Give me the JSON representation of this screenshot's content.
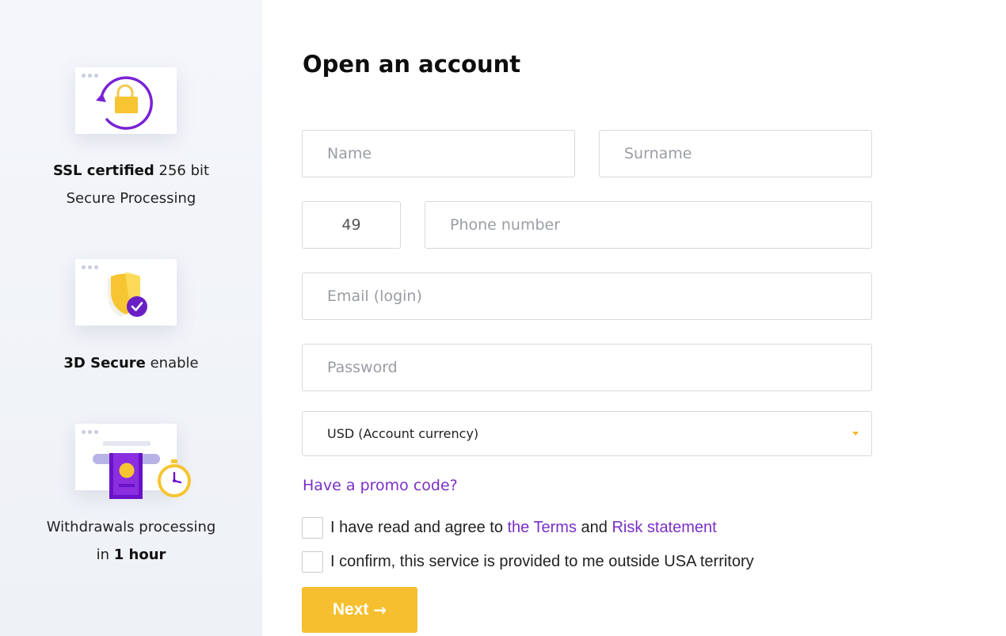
{
  "sidebar": {
    "features": [
      {
        "bold": "SSL certified",
        "rest": " 256 bit",
        "line2": "Secure Processing",
        "icon": "padlock-refresh-icon"
      },
      {
        "bold": "3D Secure",
        "rest": " enable",
        "icon": "shield-check-icon"
      },
      {
        "line1": "Withdrawals processing",
        "prefix": "in ",
        "bold": "1 hour",
        "icon": "cash-withdrawal-stopwatch-icon"
      }
    ]
  },
  "form": {
    "title": "Open an account",
    "name_placeholder": "Name",
    "surname_placeholder": "Surname",
    "phone_code": "49",
    "phone_placeholder": "Phone number",
    "email_placeholder": "Email (login)",
    "password_placeholder": "Password",
    "currency_selected": "USD (Account currency)",
    "promo_link": "Have a promo code?",
    "agree": {
      "prefix": "I have read and agree to ",
      "terms_link": "the Terms",
      "middle": " and ",
      "risk_link": "Risk statement"
    },
    "confirm_text": "I confirm, this service is provided to me outside USA territory",
    "next_label": "Next",
    "next_arrow": "→"
  },
  "colors": {
    "accent_purple": "#7a2fc7",
    "button_yellow": "#f5bf2f",
    "icon_yellow": "#f7c531"
  }
}
